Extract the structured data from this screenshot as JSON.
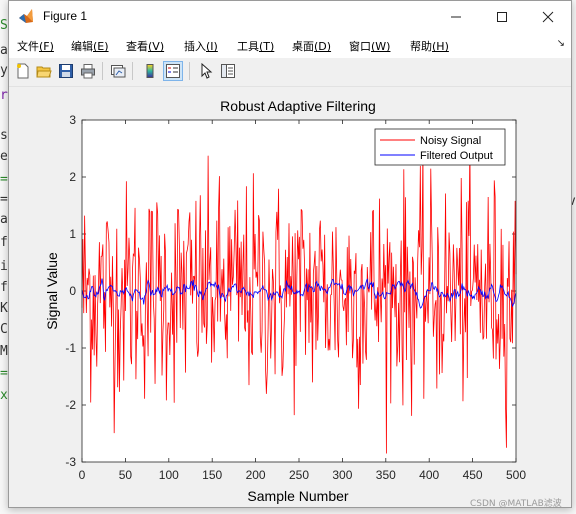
{
  "window": {
    "title": "Figure 1",
    "buttons": [
      "minimize-icon",
      "maximize-icon",
      "close-icon"
    ]
  },
  "menu": {
    "items": [
      {
        "label": "文件",
        "key": "(F)"
      },
      {
        "label": "编辑",
        "key": "(E)"
      },
      {
        "label": "查看",
        "key": "(V)"
      },
      {
        "label": "插入",
        "key": "(I)"
      },
      {
        "label": "工具",
        "key": "(T)"
      },
      {
        "label": "桌面",
        "key": "(D)"
      },
      {
        "label": "窗口",
        "key": "(W)"
      },
      {
        "label": "帮助",
        "key": "(H)"
      }
    ],
    "overflow_icon": "dock-arrow-icon"
  },
  "toolbar": {
    "icons": [
      "new-figure-icon",
      "open-file-icon",
      "save-icon",
      "print-icon",
      "link-plot-icon",
      "colorbar-icon",
      "legend-icon",
      "edit-plot-icon",
      "property-inspector-icon"
    ]
  },
  "background": {
    "code_fragments": [
      "S",
      "ar",
      "y",
      "r",
      "s",
      "e",
      "=",
      "=",
      "a",
      "f",
      "i",
      "f",
      "K",
      "C",
      "M",
      "=",
      "x"
    ],
    "right_fragment": "v"
  },
  "chart_data": {
    "type": "line",
    "title": "Robust Adaptive Filtering",
    "xlabel": "Sample Number",
    "ylabel": "Signal Value",
    "xlim": [
      0,
      500
    ],
    "ylim": [
      -3,
      3
    ],
    "xticks": [
      0,
      50,
      100,
      150,
      200,
      250,
      300,
      350,
      400,
      450,
      500
    ],
    "yticks": [
      -3,
      -2,
      -1,
      0,
      1,
      2,
      3
    ],
    "grid": false,
    "legend_position": "top-right",
    "series": [
      {
        "name": "Noisy Signal",
        "color": "#ff0000",
        "noise_amplitude_std": 0.95,
        "min": -2.85,
        "max": 2.75,
        "samples": 500
      },
      {
        "name": "Filtered Output",
        "color": "#0000ff",
        "noise_amplitude_std": 0.1,
        "min": -0.3,
        "max": 0.32,
        "samples": 500
      }
    ]
  },
  "watermark": "CSDN @MATLAB滤波"
}
